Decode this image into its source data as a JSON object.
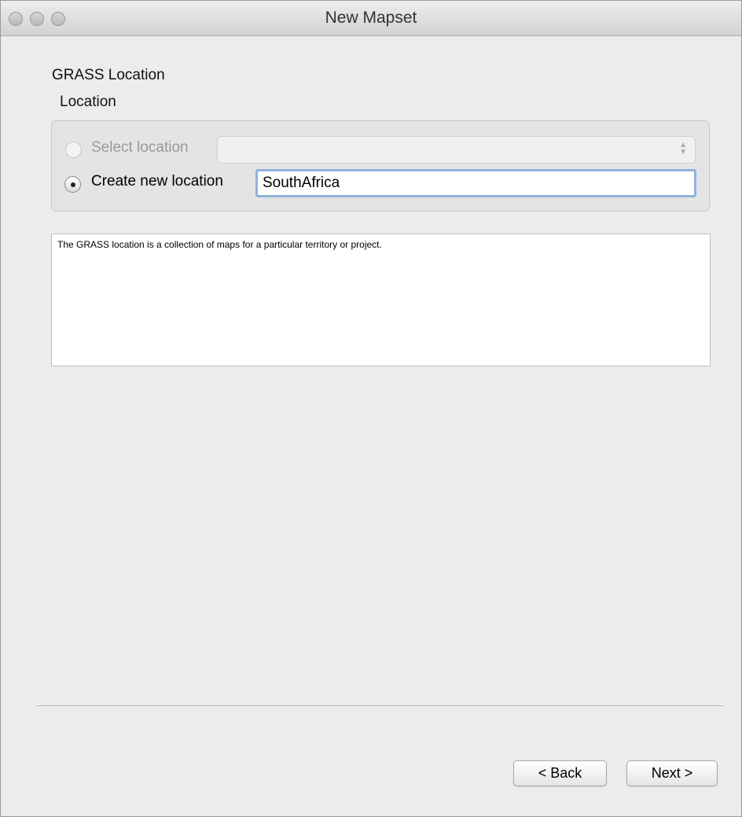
{
  "window": {
    "title": "New Mapset"
  },
  "page": {
    "heading": "GRASS Location",
    "group_label": "Location"
  },
  "location": {
    "select_label": "Select location",
    "select_value": "",
    "create_label": "Create new location",
    "create_value": "SouthAfrica"
  },
  "description": {
    "text": "The GRASS location is a collection of maps for a particular territory or project."
  },
  "buttons": {
    "back": "< Back",
    "next": "Next >"
  },
  "icons": {
    "traffic_lights": [
      "close-icon",
      "minimize-icon",
      "zoom-icon"
    ],
    "select_arrows": "up-down-arrows-icon"
  }
}
